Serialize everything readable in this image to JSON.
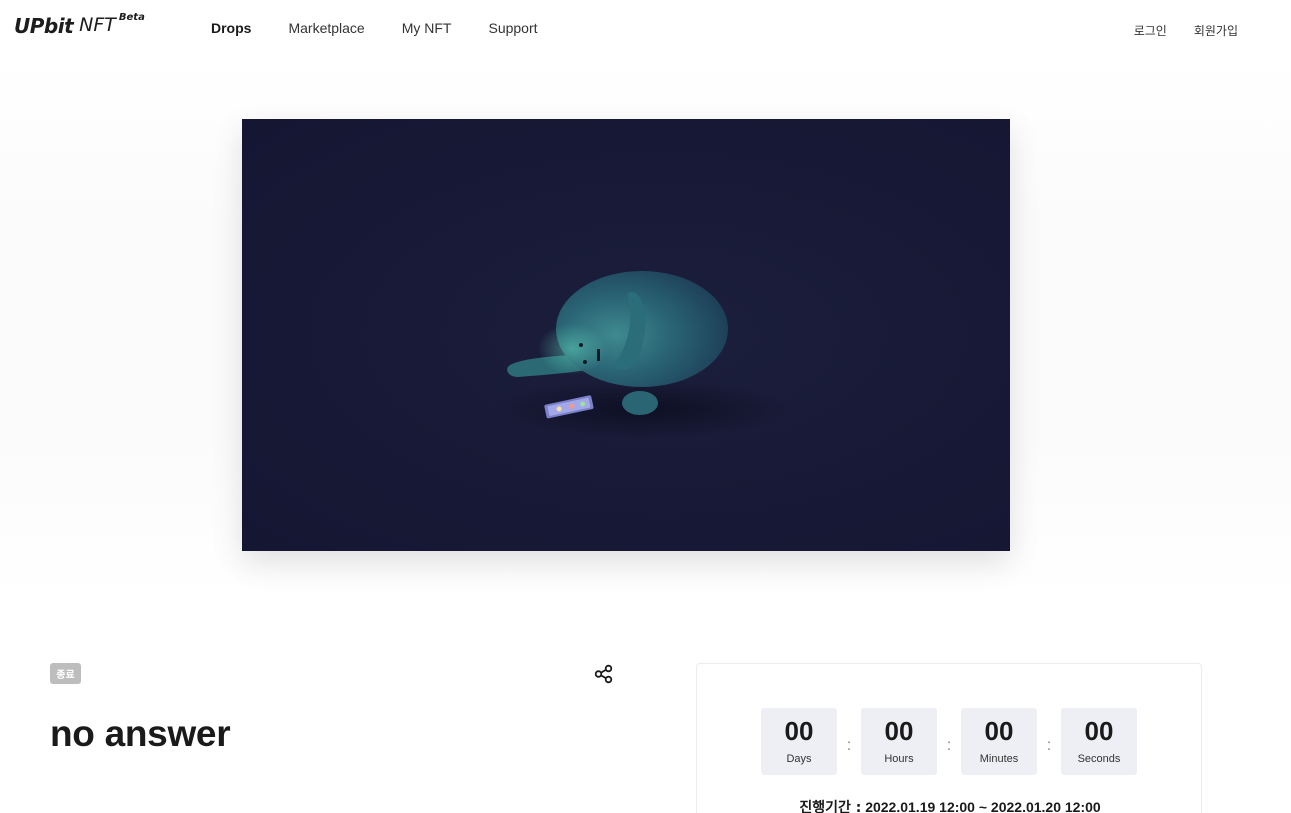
{
  "header": {
    "logo_main": "UPbit",
    "logo_nft": "NFT",
    "logo_beta": "Beta",
    "nav": [
      {
        "label": "Drops",
        "active": true
      },
      {
        "label": "Marketplace",
        "active": false
      },
      {
        "label": "My NFT",
        "active": false
      },
      {
        "label": "Support",
        "active": false
      }
    ],
    "login": "로그인",
    "signup": "회원가입"
  },
  "drop": {
    "status": "종료",
    "title": "no answer",
    "share_icon": "share-icon"
  },
  "countdown": {
    "days": "00",
    "days_label": "Days",
    "hours": "00",
    "hours_label": "Hours",
    "minutes": "00",
    "minutes_label": "Minutes",
    "seconds": "00",
    "seconds_label": "Seconds",
    "separator": ":"
  },
  "period": {
    "label": "진행기간 :",
    "value": "2022.01.19 12:00 ~ 2022.01.20 12:00"
  },
  "colors": {
    "artwork_bg": "#171936",
    "badge_bg": "#bdbdbd",
    "countdown_box": "#eeeff4"
  }
}
